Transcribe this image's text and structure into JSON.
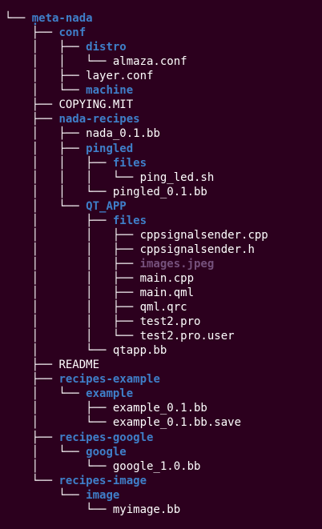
{
  "colors": {
    "background": "#2c001e",
    "file": "#ffffff",
    "directory": "#3f7fc9",
    "image_file": "#75507b"
  },
  "tree": {
    "root": ".",
    "lines": [
      {
        "prefix": "└── ",
        "name": "meta-nada",
        "kind": "dir"
      },
      {
        "prefix": "    ├── ",
        "name": "conf",
        "kind": "dir"
      },
      {
        "prefix": "    │   ├── ",
        "name": "distro",
        "kind": "dir"
      },
      {
        "prefix": "    │   │   └── ",
        "name": "almaza.conf",
        "kind": "file"
      },
      {
        "prefix": "    │   ├── ",
        "name": "layer.conf",
        "kind": "file"
      },
      {
        "prefix": "    │   └── ",
        "name": "machine",
        "kind": "dir"
      },
      {
        "prefix": "    ├── ",
        "name": "COPYING.MIT",
        "kind": "file"
      },
      {
        "prefix": "    ├── ",
        "name": "nada-recipes",
        "kind": "dir"
      },
      {
        "prefix": "    │   ├── ",
        "name": "nada_0.1.bb",
        "kind": "file"
      },
      {
        "prefix": "    │   ├── ",
        "name": "pingled",
        "kind": "dir"
      },
      {
        "prefix": "    │   │   ├── ",
        "name": "files",
        "kind": "dir"
      },
      {
        "prefix": "    │   │   │   └── ",
        "name": "ping_led.sh",
        "kind": "file"
      },
      {
        "prefix": "    │   │   └── ",
        "name": "pingled_0.1.bb",
        "kind": "file"
      },
      {
        "prefix": "    │   └── ",
        "name": "QT_APP",
        "kind": "dir"
      },
      {
        "prefix": "    │       ├── ",
        "name": "files",
        "kind": "dir"
      },
      {
        "prefix": "    │       │   ├── ",
        "name": "cppsignalsender.cpp",
        "kind": "file"
      },
      {
        "prefix": "    │       │   ├── ",
        "name": "cppsignalsender.h",
        "kind": "file"
      },
      {
        "prefix": "    │       │   ├── ",
        "name": "images.jpeg",
        "kind": "img"
      },
      {
        "prefix": "    │       │   ├── ",
        "name": "main.cpp",
        "kind": "file"
      },
      {
        "prefix": "    │       │   ├── ",
        "name": "main.qml",
        "kind": "file"
      },
      {
        "prefix": "    │       │   ├── ",
        "name": "qml.qrc",
        "kind": "file"
      },
      {
        "prefix": "    │       │   ├── ",
        "name": "test2.pro",
        "kind": "file"
      },
      {
        "prefix": "    │       │   └── ",
        "name": "test2.pro.user",
        "kind": "file"
      },
      {
        "prefix": "    │       └── ",
        "name": "qtapp.bb",
        "kind": "file"
      },
      {
        "prefix": "    ├── ",
        "name": "README",
        "kind": "file"
      },
      {
        "prefix": "    ├── ",
        "name": "recipes-example",
        "kind": "dir"
      },
      {
        "prefix": "    │   └── ",
        "name": "example",
        "kind": "dir"
      },
      {
        "prefix": "    │       ├── ",
        "name": "example_0.1.bb",
        "kind": "file"
      },
      {
        "prefix": "    │       └── ",
        "name": "example_0.1.bb.save",
        "kind": "file"
      },
      {
        "prefix": "    ├── ",
        "name": "recipes-google",
        "kind": "dir"
      },
      {
        "prefix": "    │   └── ",
        "name": "google",
        "kind": "dir"
      },
      {
        "prefix": "    │       └── ",
        "name": "google_1.0.bb",
        "kind": "file"
      },
      {
        "prefix": "    └── ",
        "name": "recipes-image",
        "kind": "dir"
      },
      {
        "prefix": "        └── ",
        "name": "image",
        "kind": "dir"
      },
      {
        "prefix": "            └── ",
        "name": "myimage.bb",
        "kind": "file"
      }
    ]
  }
}
